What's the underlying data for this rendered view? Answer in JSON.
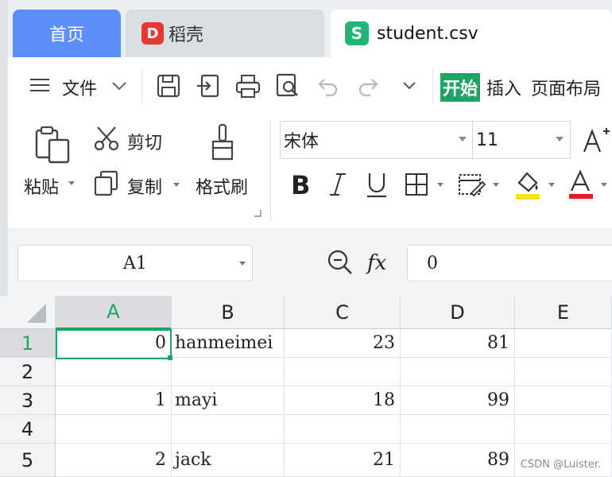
{
  "tabs": {
    "home": "首页",
    "docer_logo": "D",
    "docer": "稻壳",
    "file_logo": "S",
    "file": "student.csv"
  },
  "menu": {
    "file": "文件",
    "start": "开始",
    "insert": "插入",
    "page_layout": "页面布局"
  },
  "clipboard": {
    "paste": "粘贴",
    "cut": "剪切",
    "copy": "复制",
    "format_painter": "格式刷"
  },
  "font": {
    "name": "宋体",
    "size": "11"
  },
  "formula_bar": {
    "cell_ref": "A1",
    "fx": "fx",
    "value": "0"
  },
  "grid": {
    "columns": [
      "A",
      "B",
      "C",
      "D",
      "E"
    ],
    "rows": [
      "1",
      "2",
      "3",
      "4",
      "5"
    ],
    "cells": [
      [
        "0",
        "hanmeimei",
        "23",
        "81",
        ""
      ],
      [
        "",
        "",
        "",
        "",
        ""
      ],
      [
        "1",
        "mayi",
        "18",
        "99",
        ""
      ],
      [
        "",
        "",
        "",
        "",
        ""
      ],
      [
        "2",
        "jack",
        "21",
        "89",
        ""
      ]
    ],
    "selected": "A1"
  },
  "colors": {
    "home_tab": "#5b8ff9",
    "accent_green": "#20a466",
    "highlight_yellow": "#f5e31b",
    "font_red": "#e02020"
  },
  "watermark": "CSDN @Luister."
}
